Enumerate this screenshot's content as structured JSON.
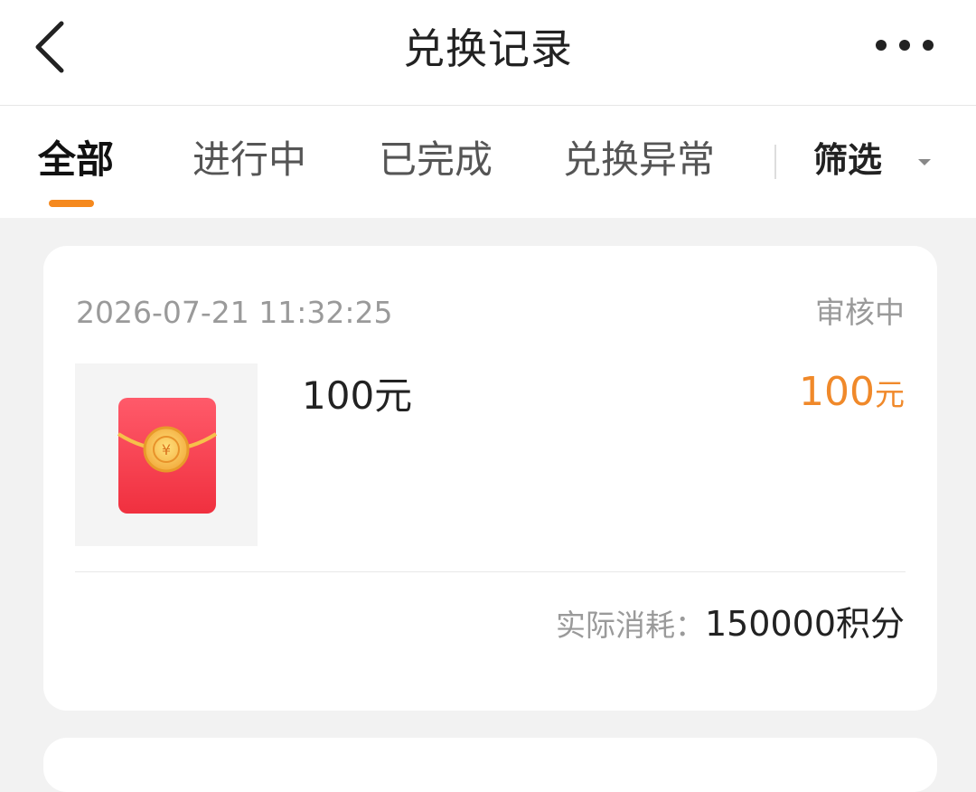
{
  "header": {
    "title": "兑换记录",
    "back_icon": "chevron-left-icon",
    "more_icon": "more-horizontal-icon"
  },
  "tabs": [
    {
      "label": "全部",
      "active": true
    },
    {
      "label": "进行中",
      "active": false
    },
    {
      "label": "已完成",
      "active": false
    },
    {
      "label": "兑换异常",
      "active": false
    }
  ],
  "filter": {
    "label": "筛选",
    "icon": "caret-down-icon"
  },
  "records": [
    {
      "time": "2026-07-21 11:32:25",
      "status": "审核中",
      "item_name": "100元",
      "price_value": "100",
      "price_unit": "元",
      "cost_label": "实际消耗：",
      "cost_value": "150000积分",
      "thumb_icon": "red-envelope-icon"
    }
  ],
  "colors": {
    "accent": "#f5891e",
    "price": "#f0892a",
    "muted_text": "#9a9a9a",
    "background": "#f2f2f2",
    "envelope_red": "#f4364c",
    "envelope_gold": "#f6c04a"
  }
}
